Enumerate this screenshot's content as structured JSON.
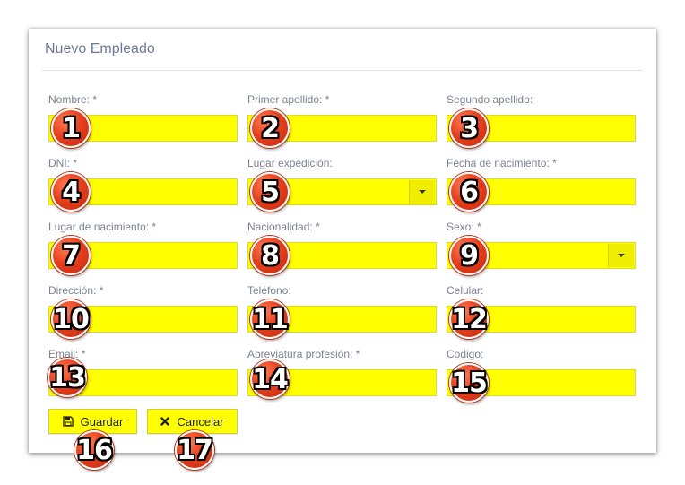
{
  "form": {
    "title": "Nuevo Empleado",
    "fields": {
      "nombre": {
        "label": "Nombre:",
        "required": "*",
        "value": "",
        "badge": "1"
      },
      "primer_apellido": {
        "label": "Primer apellido:",
        "required": "*",
        "value": "",
        "badge": "2"
      },
      "segundo_apellido": {
        "label": "Segundo apellido:",
        "required": "",
        "value": "",
        "badge": "3"
      },
      "dni": {
        "label": "DNI:",
        "required": "*",
        "value": "",
        "badge": "4"
      },
      "lugar_expedicion": {
        "label": "Lugar expedición:",
        "required": "",
        "value": "",
        "badge": "5"
      },
      "fecha_nacimiento": {
        "label": "Fecha de nacimiento:",
        "required": "*",
        "value": "",
        "badge": "6"
      },
      "lugar_nacimiento": {
        "label": "Lugar de nacimiento:",
        "required": "*",
        "value": "",
        "badge": "7"
      },
      "nacionalidad": {
        "label": "Nacionalidad:",
        "required": "*",
        "value": "",
        "badge": "8"
      },
      "sexo": {
        "label": "Sexo:",
        "required": "*",
        "value": "",
        "badge": "9"
      },
      "direccion": {
        "label": "Dirección:",
        "required": "*",
        "value": "",
        "badge": "10"
      },
      "telefono": {
        "label": "Teléfono:",
        "required": "",
        "value": "",
        "badge": "11"
      },
      "celular": {
        "label": "Celular:",
        "required": "",
        "value": "",
        "badge": "12"
      },
      "email": {
        "label": "Email:",
        "required": "*",
        "value": "",
        "badge": "13"
      },
      "abreviatura": {
        "label": "Abreviatura profesión:",
        "required": "*",
        "value": "",
        "badge": "14"
      },
      "codigo": {
        "label": "Codigo:",
        "required": "",
        "value": "",
        "badge": "15"
      }
    },
    "buttons": {
      "save": {
        "label": "Guardar",
        "icon": "save-icon",
        "badge": "16"
      },
      "cancel": {
        "label": "Cancelar",
        "icon": "close-icon",
        "badge": "17"
      }
    }
  },
  "colors": {
    "highlight": "#ffff00",
    "badge": "#e8401e",
    "title": "#6b7894",
    "label": "#7b8291"
  }
}
